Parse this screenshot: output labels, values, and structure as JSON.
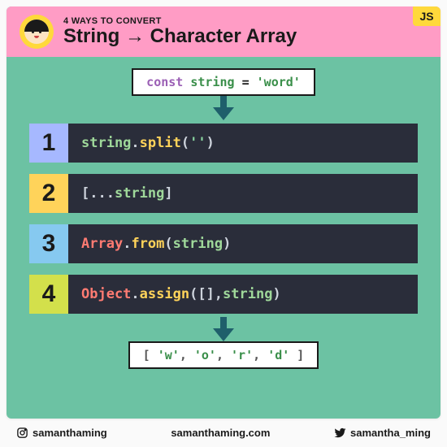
{
  "header": {
    "subtitle": "4 WAYS TO CONVERT",
    "title": "String → Character Array",
    "badge": "JS"
  },
  "input": {
    "kw": "const",
    "var": "string",
    "eq": " = ",
    "str": "'word'"
  },
  "methods": [
    {
      "num": "1",
      "tokens": [
        {
          "cls": "tk-var",
          "t": "string"
        },
        {
          "cls": "tk-punc",
          "t": "."
        },
        {
          "cls": "tk-fn",
          "t": "split"
        },
        {
          "cls": "tk-punc",
          "t": "("
        },
        {
          "cls": "tk-str",
          "t": "''"
        },
        {
          "cls": "tk-punc",
          "t": ")"
        }
      ]
    },
    {
      "num": "2",
      "tokens": [
        {
          "cls": "tk-punc",
          "t": "[..."
        },
        {
          "cls": "tk-var",
          "t": "string"
        },
        {
          "cls": "tk-punc",
          "t": "]"
        }
      ]
    },
    {
      "num": "3",
      "tokens": [
        {
          "cls": "tk-obj",
          "t": "Array"
        },
        {
          "cls": "tk-punc",
          "t": "."
        },
        {
          "cls": "tk-fn",
          "t": "from"
        },
        {
          "cls": "tk-punc",
          "t": "("
        },
        {
          "cls": "tk-var",
          "t": "string"
        },
        {
          "cls": "tk-punc",
          "t": ")"
        }
      ]
    },
    {
      "num": "4",
      "tokens": [
        {
          "cls": "tk-obj",
          "t": "Object"
        },
        {
          "cls": "tk-punc",
          "t": "."
        },
        {
          "cls": "tk-fn",
          "t": "assign"
        },
        {
          "cls": "tk-punc",
          "t": "([], "
        },
        {
          "cls": "tk-var",
          "t": "string"
        },
        {
          "cls": "tk-punc",
          "t": ")"
        }
      ]
    }
  ],
  "output": {
    "tokens": [
      {
        "cls": "tk-punc",
        "t": "[ "
      },
      {
        "cls": "tk-str",
        "t": "'w'"
      },
      {
        "cls": "tk-punc",
        "t": ", "
      },
      {
        "cls": "tk-str",
        "t": "'o'"
      },
      {
        "cls": "tk-punc",
        "t": ", "
      },
      {
        "cls": "tk-str",
        "t": "'r'"
      },
      {
        "cls": "tk-punc",
        "t": ", "
      },
      {
        "cls": "tk-str",
        "t": "'d'"
      },
      {
        "cls": "tk-punc",
        "t": " ]"
      }
    ]
  },
  "footer": {
    "instagram": "samanthaming",
    "site": "samanthaming.com",
    "twitter": "samantha_ming"
  }
}
